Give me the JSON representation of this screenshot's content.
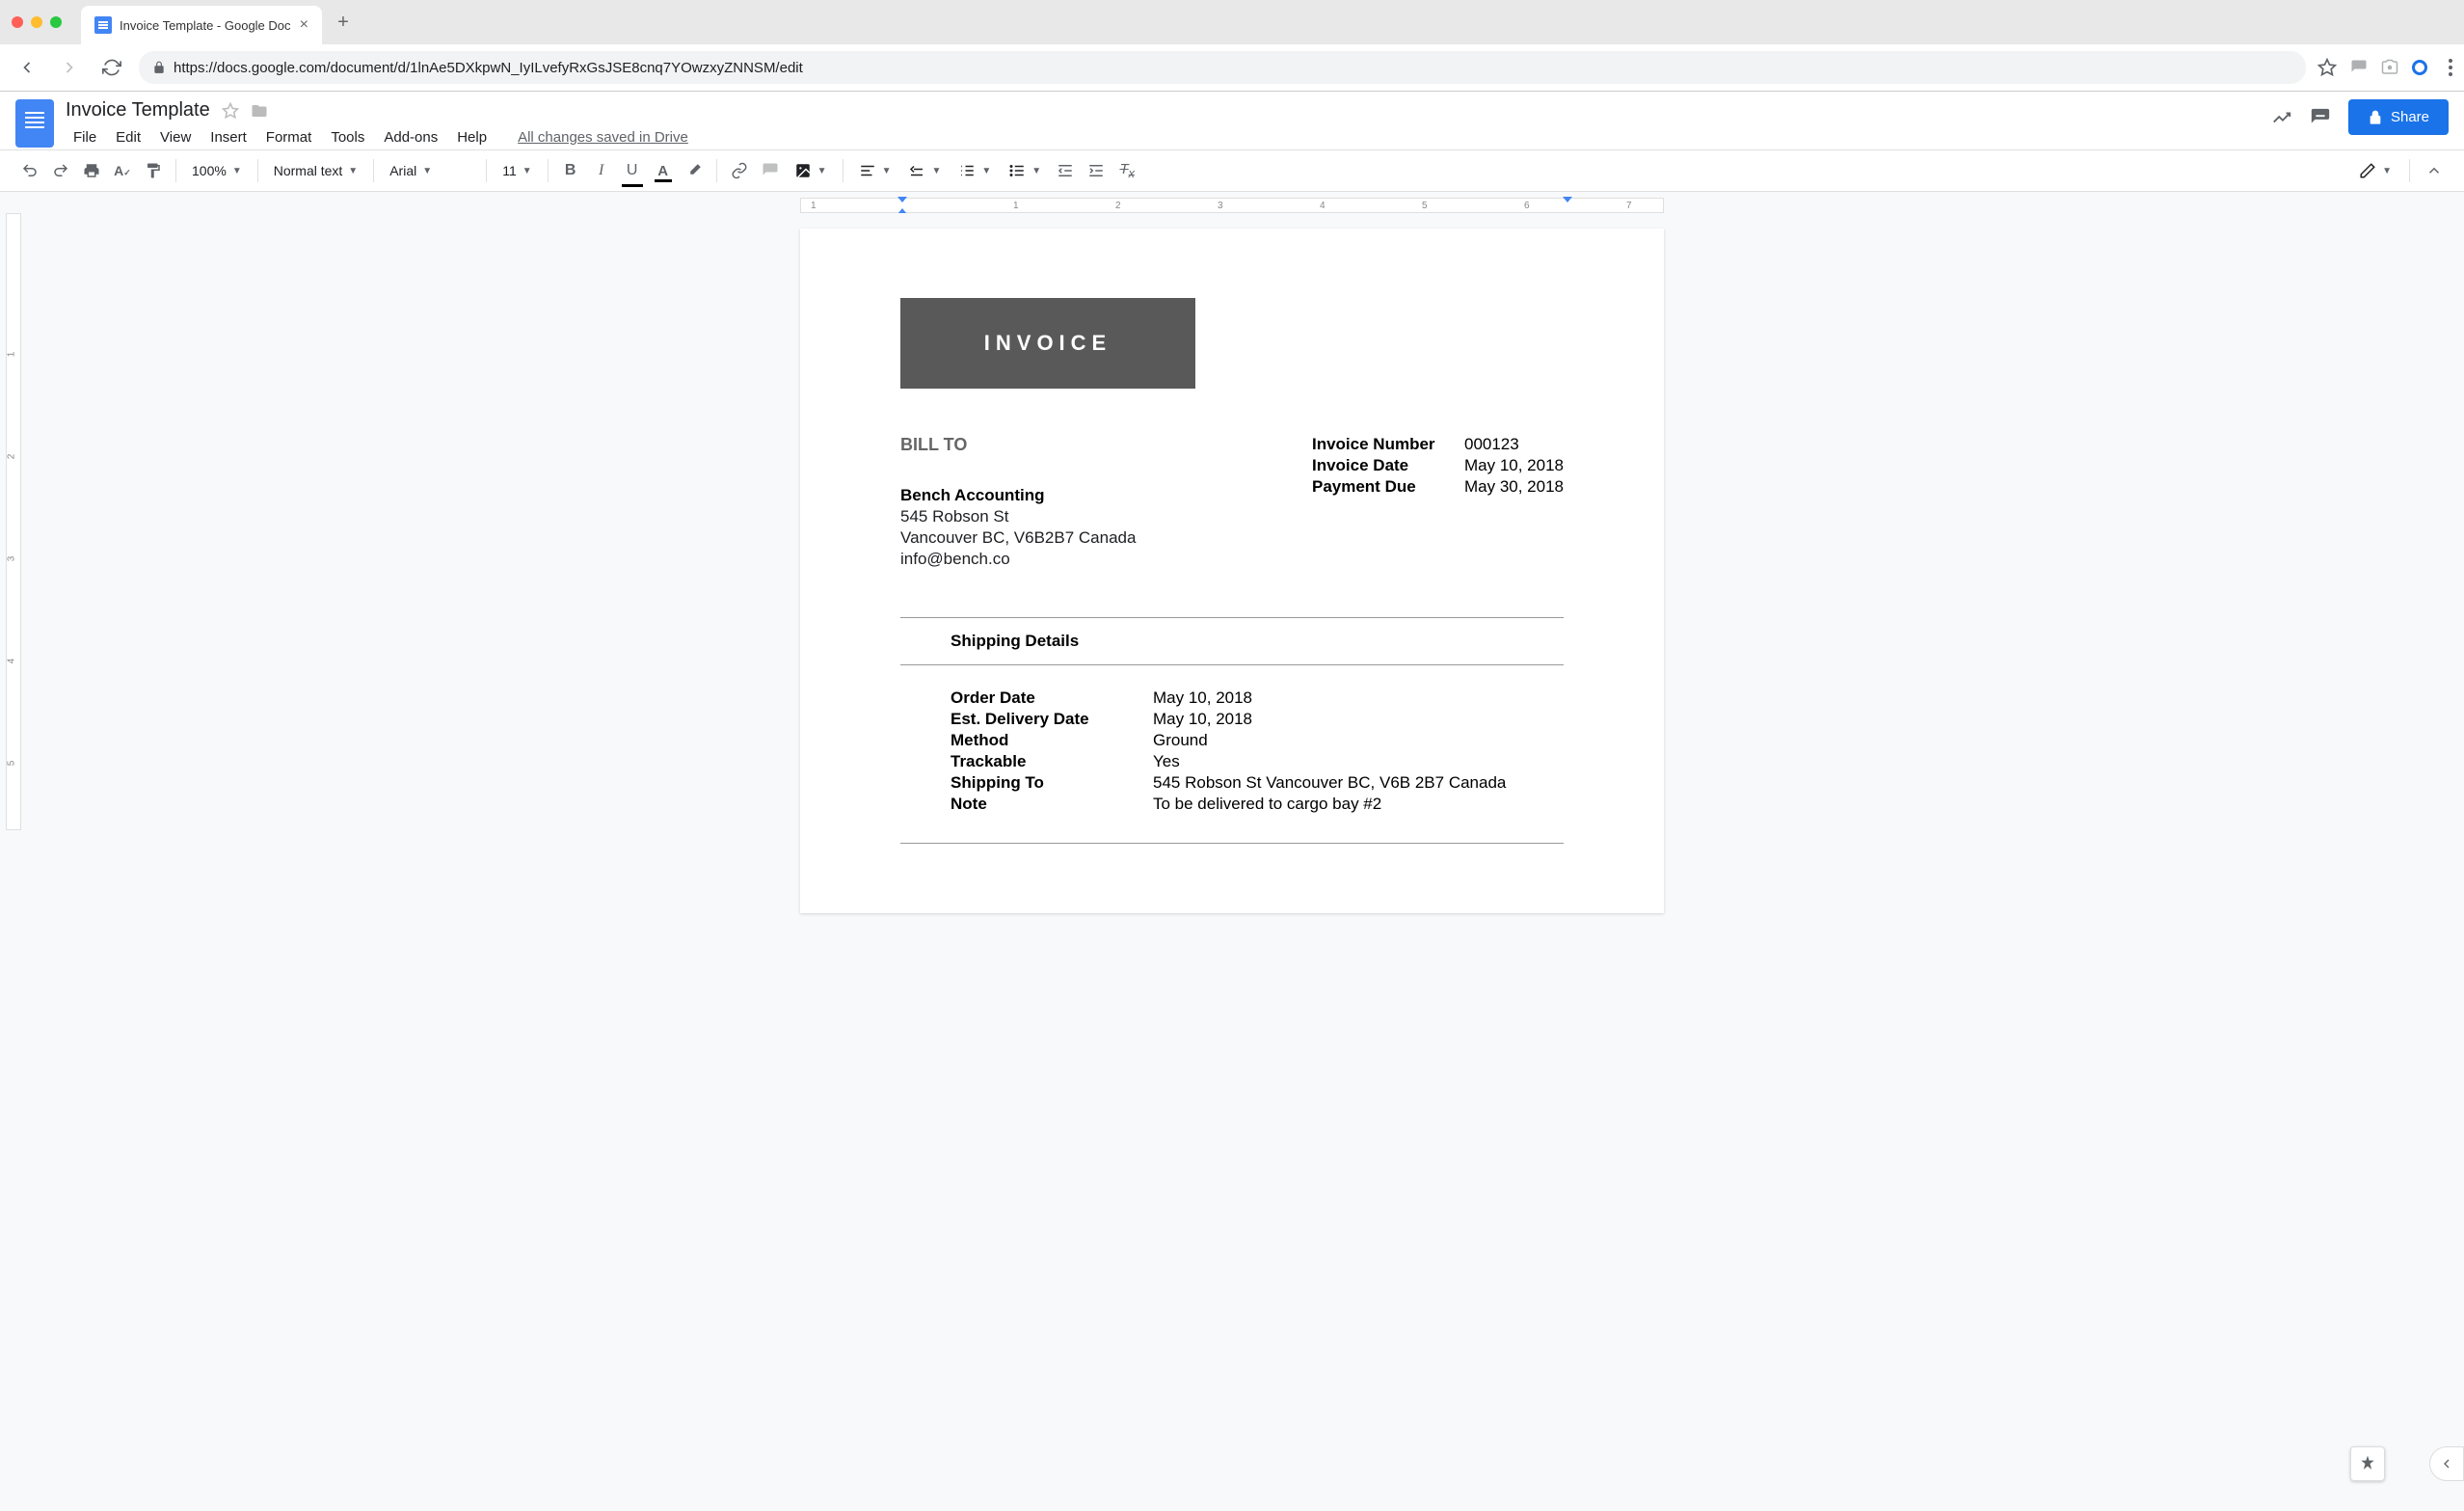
{
  "browser": {
    "tab_title": "Invoice Template - Google Doc",
    "url": "https://docs.google.com/document/d/1lnAe5DXkpwN_IyILvefyRxGsJSE8cnq7YOwzxyZNNSM/edit"
  },
  "docs": {
    "title": "Invoice Template",
    "menus": [
      "File",
      "Edit",
      "View",
      "Insert",
      "Format",
      "Tools",
      "Add-ons",
      "Help"
    ],
    "save_status": "All changes saved in Drive",
    "share_label": "Share"
  },
  "toolbar": {
    "zoom": "100%",
    "style": "Normal text",
    "font": "Arial",
    "size": "11"
  },
  "ruler": {
    "marks": [
      "1",
      "1",
      "2",
      "3",
      "4",
      "5",
      "6",
      "7"
    ]
  },
  "document": {
    "banner": "INVOICE",
    "bill_to_heading": "BILL TO",
    "bill_to": {
      "name": "Bench Accounting",
      "street": "545 Robson St",
      "city": "Vancouver BC, V6B2B7 Canada",
      "email": "info@bench.co"
    },
    "meta": [
      {
        "label": "Invoice Number",
        "value": "000123"
      },
      {
        "label": "Invoice Date",
        "value": "May 10, 2018"
      },
      {
        "label": "Payment Due",
        "value": "May 30, 2018"
      }
    ],
    "shipping_heading": "Shipping Details",
    "shipping": [
      {
        "label": "Order Date",
        "value": "May 10, 2018"
      },
      {
        "label": "Est. Delivery Date",
        "value": "May 10, 2018"
      },
      {
        "label": "Method",
        "value": "Ground"
      },
      {
        "label": "Trackable",
        "value": "Yes"
      },
      {
        "label": "Shipping To",
        "value": "545 Robson St Vancouver BC, V6B 2B7 Canada"
      },
      {
        "label": "Note",
        "value": "To be delivered to cargo bay #2"
      }
    ]
  }
}
